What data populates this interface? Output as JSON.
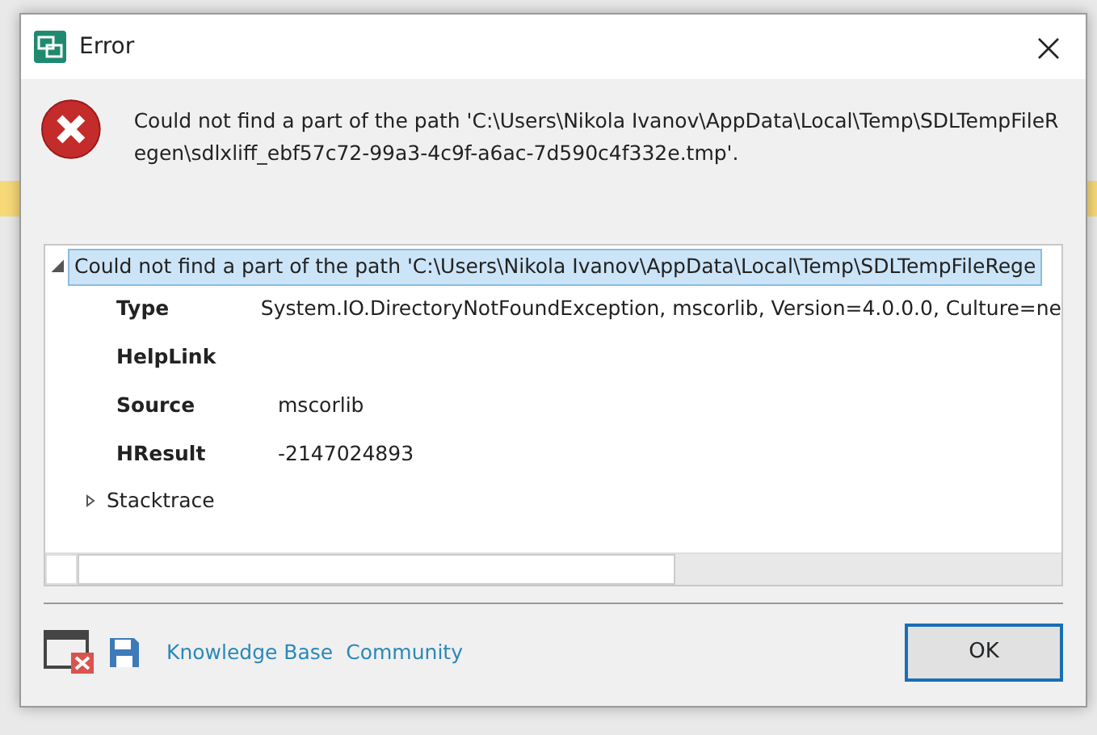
{
  "window": {
    "title": "Error"
  },
  "message": "Could not find a part of the path 'C:\\Users\\Nikola Ivanov\\AppData\\Local\\Temp\\SDLTempFileRegen\\sdlxliff_ebf57c72-99a3-4c9f-a6ac-7d590c4f332e.tmp'.",
  "tree": {
    "label": "Could not find a part of the path 'C:\\Users\\Nikola Ivanov\\AppData\\Local\\Temp\\SDLTempFileRege",
    "expanded": true,
    "selected": true,
    "children": [
      {
        "name": "Type",
        "value": "System.IO.DirectoryNotFoundException, mscorlib, Version=4.0.0.0, Culture=ne"
      },
      {
        "name": "HelpLink"
      },
      {
        "name": "Source",
        "value": "mscorlib"
      },
      {
        "name": "HResult",
        "value": "-2147024893"
      }
    ],
    "extra": [
      {
        "label": "Stacktrace",
        "expanded": false
      }
    ]
  },
  "links": [
    "Knowledge Base",
    "Community"
  ],
  "buttons": [
    "OK"
  ]
}
